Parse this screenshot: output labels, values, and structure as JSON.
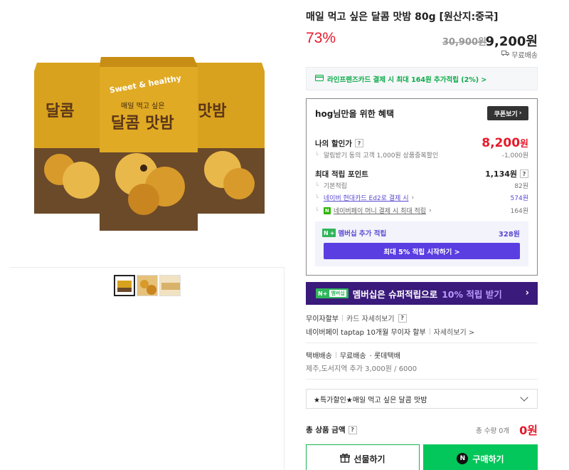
{
  "product": {
    "title": "매일 먹고 싶은 달콤 맛밤 80g [원산지:중국]",
    "discount_rate": "73%",
    "original_price": "30,900원",
    "sale_price": "9,200원",
    "delivery": "무료배송",
    "package_text": {
      "top": "매일 먹고 싶은",
      "main": "달콤 맛밤",
      "badge": "Sweet & healthy"
    }
  },
  "card_banner": "라인프렌즈카드 결제 시 최대 164원 추가적립 (2%) >",
  "benefits": {
    "title": "hog님만을 위한 혜택",
    "coupon_button": "쿠폰보기",
    "my_discount_label": "나의 할인가",
    "my_discount_amount": "8,200",
    "my_discount_unit": "원",
    "alert_label": "알림받기 동의 고객 1,000원 상품중복할인",
    "alert_value": "-1,000원",
    "max_points_label": "최대 적립 포인트",
    "max_points_value": "1,134원",
    "basic_label": "기본적립",
    "basic_value": "82원",
    "hyundai_label": "네이버 현대카드 Ed2로 결제 시",
    "hyundai_value": "574원",
    "npay_label": "네이버페이 머니 결제 시 최대 적립",
    "npay_value": "164원",
    "membership_label": "멤버십 추가 적립",
    "membership_value": "328원",
    "membership_button": "최대 5% 적립 시작하기 >"
  },
  "super_banner": {
    "badge": "N+",
    "badge_sub": "멤버십",
    "text_before": "멤버십은 슈퍼적립으로",
    "text_highlight": "10% 적립 받기"
  },
  "installment": {
    "label": "무이자할부",
    "card_info": "카드 자세히보기",
    "npay_text": "네이버페이 taptap 10개월 무이자 할부",
    "details": "자세히보기 >"
  },
  "shipping": {
    "type": "택배배송",
    "free": "무료배송",
    "courier": "· 롯데택배",
    "extra": "제주,도서지역 추가 3,000원 / 6000"
  },
  "option": {
    "selected": "★특가할인★매일 먹고 싶은 달콤 맛밤"
  },
  "total": {
    "label": "총 상품 금액",
    "qty": "총 수량 0개",
    "price": "0원"
  },
  "buttons": {
    "gift": "선물하기",
    "buy": "구매하기"
  },
  "colors": {
    "accent_red": "#e6192a",
    "naver_green": "#03c75a",
    "membership_purple": "#5a3ee1",
    "banner_dark": "#3a1a7a"
  }
}
